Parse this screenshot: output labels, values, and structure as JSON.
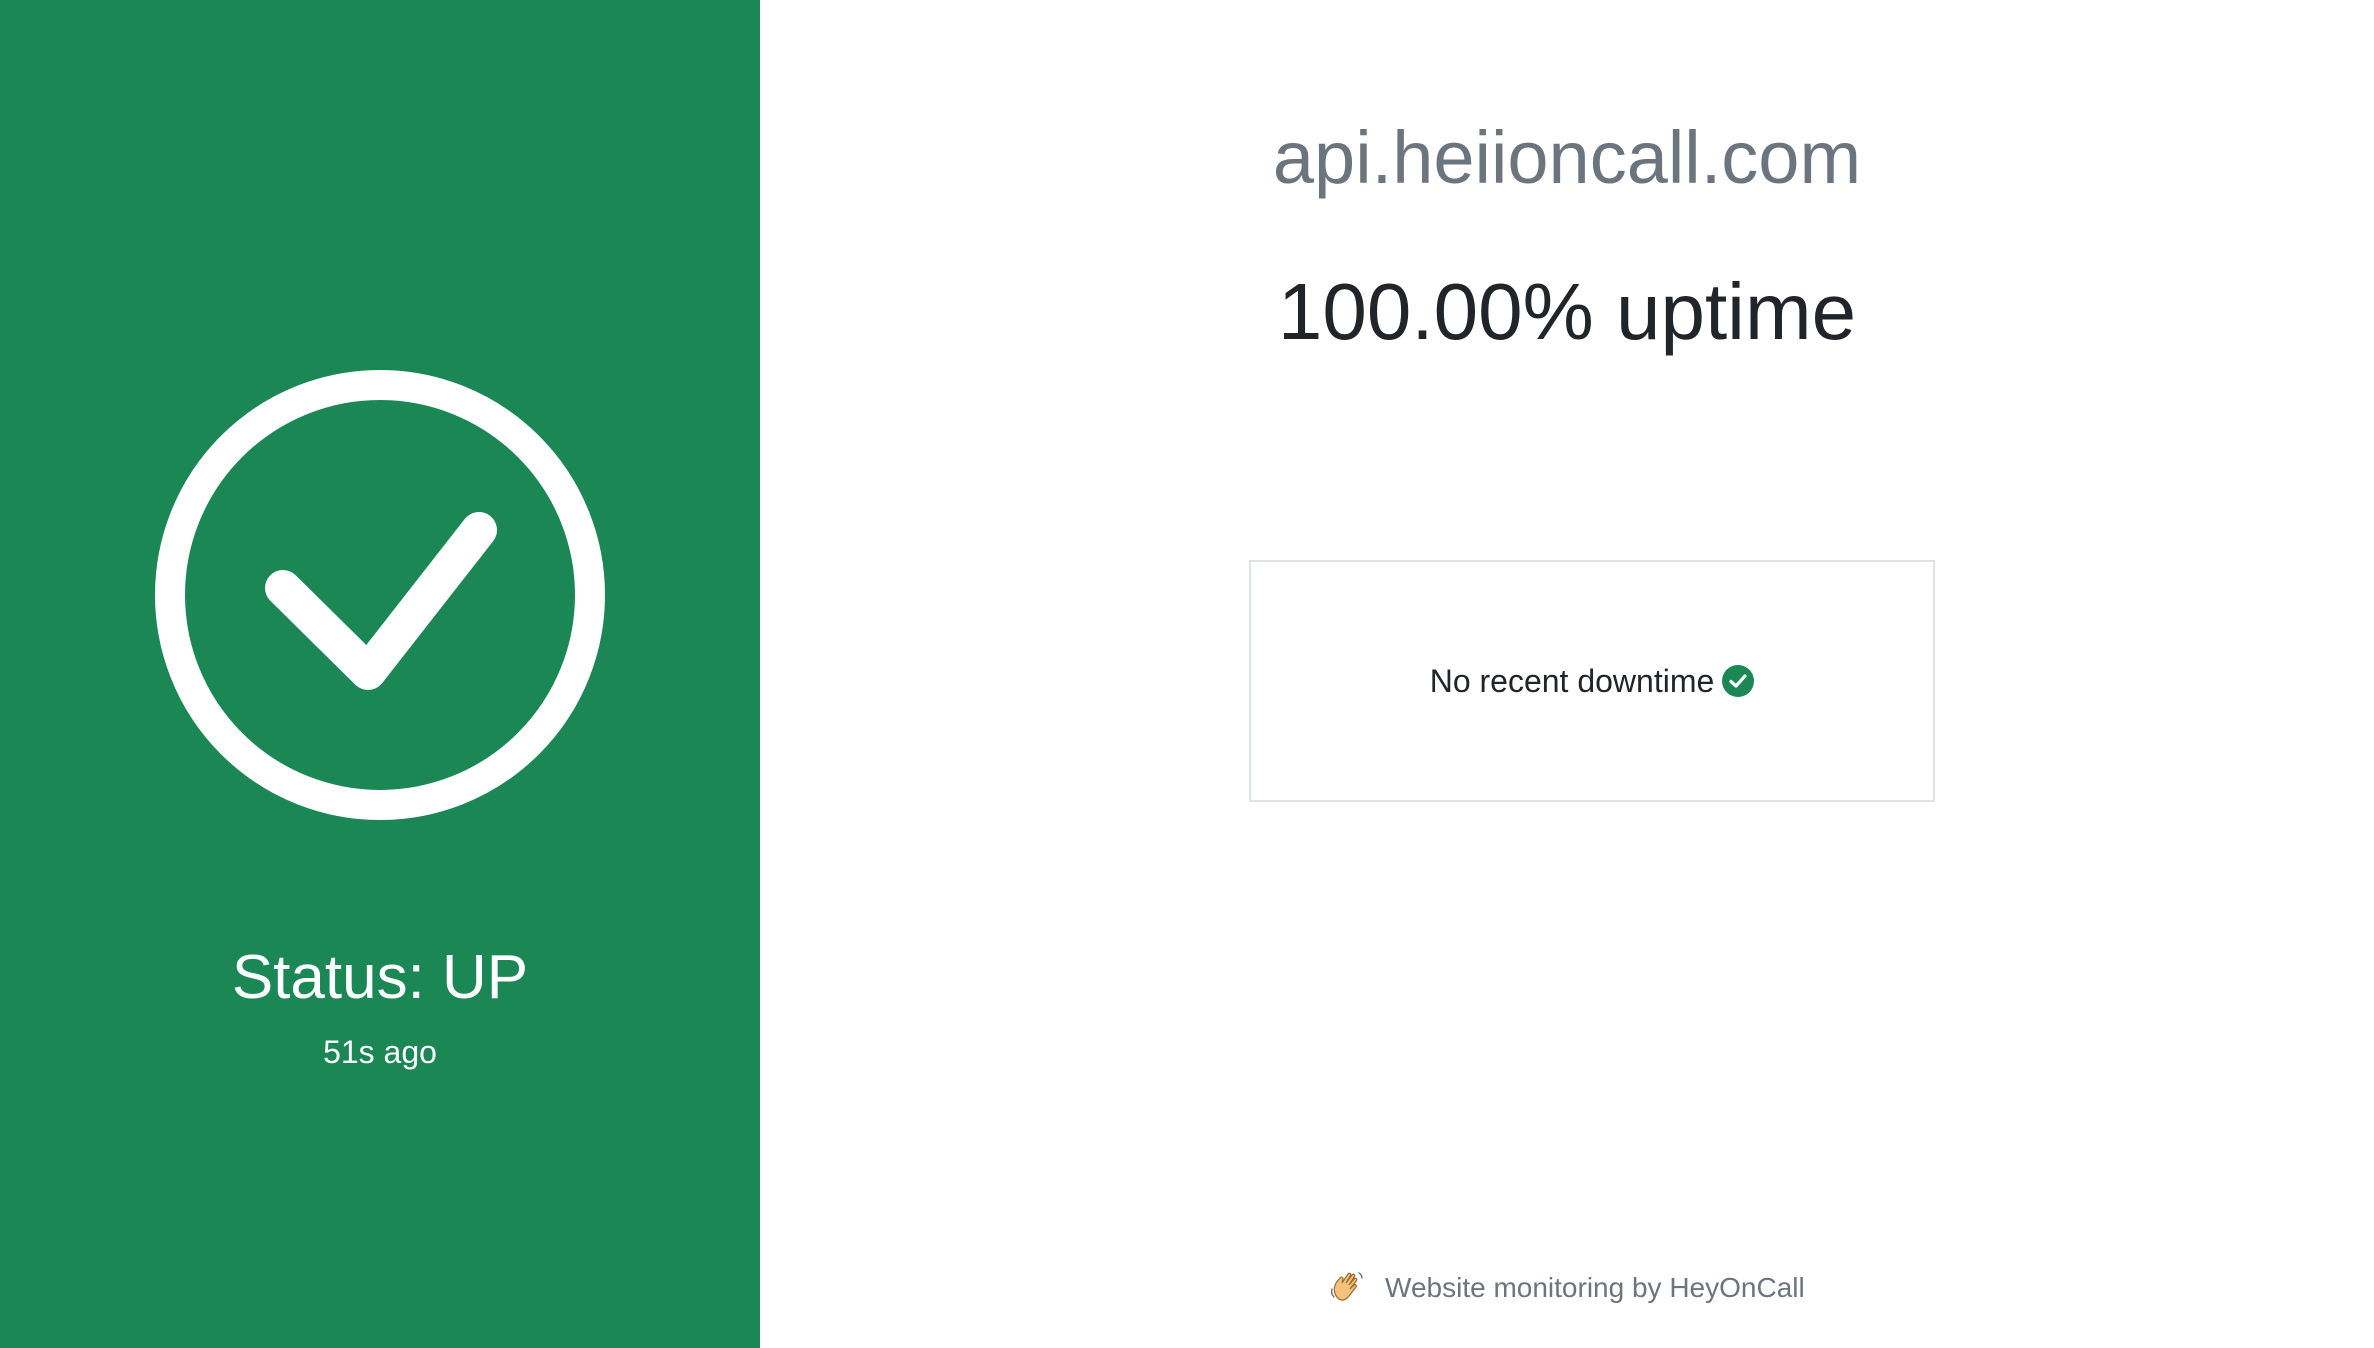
{
  "status": {
    "title": "Status: UP",
    "age": "51s ago",
    "color": "#1b8754",
    "icon": "check-circle-icon"
  },
  "site": {
    "name": "api.heiioncall.com",
    "uptime": "100.00% uptime"
  },
  "downtime": {
    "message": "No recent downtime",
    "icon": "check-badge-icon"
  },
  "footer": {
    "icon": "waving-hand-icon",
    "text": "Website monitoring by HeyOnCall"
  }
}
